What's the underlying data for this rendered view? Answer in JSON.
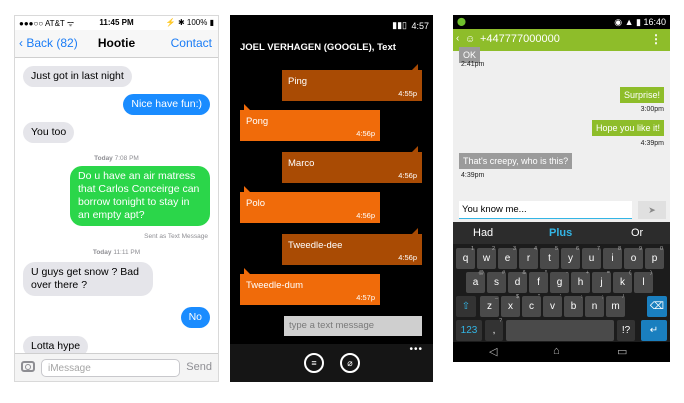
{
  "ios": {
    "status": {
      "carrier": "●●●○○ AT&T ᯤ",
      "time": "11:45 PM",
      "right": "⚡ ✱ 100% ▮"
    },
    "nav": {
      "back": "Back (82)",
      "title": "Hootie",
      "contact": "Contact"
    },
    "messages": [
      {
        "text": "Just got in last night"
      },
      {
        "text": "Nice have fun:)"
      },
      {
        "text": "You too"
      },
      {
        "text": "Do u have an air matress that Carlos Conceirge can borrow tonight to stay in an empty apt?"
      },
      {
        "text": "U guys get snow ? Bad over there ?"
      },
      {
        "text": "No"
      },
      {
        "text": "Lotta hype"
      }
    ],
    "timestamps": [
      {
        "day": "Today",
        "time": "7:08 PM"
      },
      {
        "day": "Today",
        "time": "11:11 PM"
      }
    ],
    "sent_note": "Sent as Text Message",
    "input_placeholder": "iMessage",
    "send": "Send"
  },
  "wp": {
    "status_time": "4:57",
    "title": "JOEL VERHAGEN (GOOGLE), Text",
    "messages": [
      {
        "text": "Ping",
        "time": "4:55p"
      },
      {
        "text": "Pong",
        "time": "4:56p"
      },
      {
        "text": "Marco",
        "time": "4:56p"
      },
      {
        "text": "Polo",
        "time": "4:56p"
      },
      {
        "text": "Tweedle-dee",
        "time": "4:56p"
      },
      {
        "text": "Tweedle-dum",
        "time": "4:57p"
      }
    ],
    "input_placeholder": "type a text message",
    "dots": "•••"
  },
  "android": {
    "status_time": "16:40",
    "number": "+447777000000",
    "messages": [
      {
        "text": "OK",
        "time": "2:41pm"
      },
      {
        "text": "Surprise!",
        "time": "3:00pm"
      },
      {
        "text": "Hope you like it!",
        "time": "4:39pm"
      },
      {
        "text": "That's creepy, who is this?",
        "time": "4:39pm"
      }
    ],
    "input_value": "You know me...",
    "suggestions": [
      "Had",
      "Plus",
      "Or"
    ],
    "keyboard": {
      "row1": [
        "q",
        "w",
        "e",
        "r",
        "t",
        "y",
        "u",
        "i",
        "o",
        "p"
      ],
      "row1_sup": [
        "1",
        "2",
        "3",
        "4",
        "5",
        "6",
        "7",
        "8",
        "9",
        "0"
      ],
      "row2": [
        "a",
        "s",
        "d",
        "f",
        "g",
        "h",
        "j",
        "k",
        "l"
      ],
      "row2_sup": [
        "@",
        "#",
        "&",
        "*",
        "-",
        "+",
        "=",
        "(",
        ")"
      ],
      "row3": [
        "z",
        "x",
        "c",
        "v",
        "b",
        "n",
        "m"
      ],
      "row3_sup": [
        "_",
        "$",
        "\"",
        "'",
        ":",
        ";",
        "/"
      ],
      "num_key": "123",
      "punct_key": "!?",
      "punct_sup": ",.",
      "comma_sup": "?"
    }
  }
}
